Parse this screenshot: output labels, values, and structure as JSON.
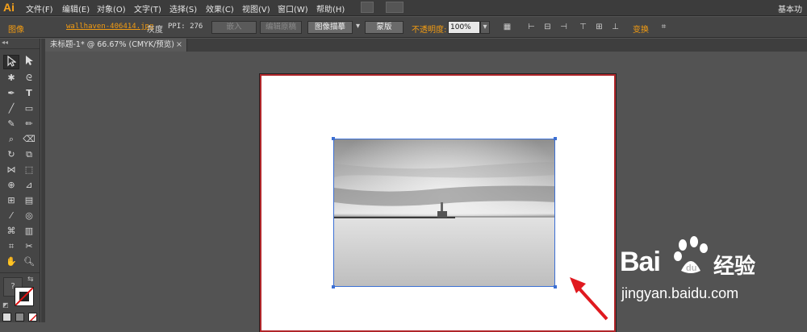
{
  "app": {
    "logo": "Ai",
    "workspace": "基本功"
  },
  "menu": [
    "文件(F)",
    "编辑(E)",
    "对象(O)",
    "文字(T)",
    "选择(S)",
    "效果(C)",
    "视图(V)",
    "窗口(W)",
    "帮助(H)"
  ],
  "control_bar": {
    "type_label": "图像",
    "filename": "wallhaven-406414.jpg",
    "color_mode": "灰度",
    "ppi": "PPI: 276",
    "embed": "嵌入",
    "edit_original": "编辑原稿",
    "image_trace": "图像描摹",
    "mask": "蒙版",
    "opacity_label": "不透明度:",
    "opacity_value": "100%",
    "transform": "变换"
  },
  "document_tab": {
    "title": "未标题-1* @ 66.67% (CMYK/预览)",
    "close": "×"
  },
  "tools_panel": {
    "collapse": "◂◂",
    "fill_stroke_question": "?"
  },
  "watermark": {
    "brand": "Bai",
    "brand_suffix": "经验",
    "url": "jingyan.baidu.com"
  },
  "colors": {
    "accent_orange": "#f39c12",
    "artboard_border": "#b0262a",
    "selection_blue": "#3b6fd4",
    "arrow_red": "#e0191f"
  }
}
